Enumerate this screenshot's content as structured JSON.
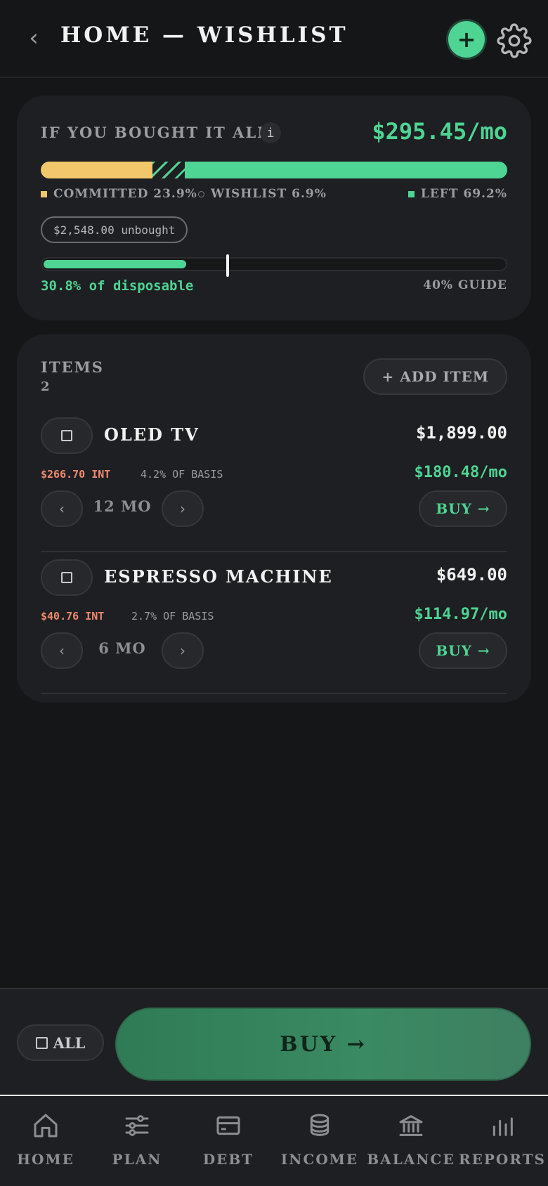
{
  "header": {
    "title": "HOME — WISHLIST"
  },
  "summary": {
    "label": "IF YOU BOUGHT IT ALL",
    "info_glyph": "i",
    "monthly_total": "$295.45/mo",
    "breakdown": {
      "committed_pct": 23.9,
      "wishlist_pct": 6.9,
      "left_pct": 69.2
    },
    "legend": {
      "committed": "COMMITTED 23.9%",
      "wishlist": "WISHLIST 6.9%",
      "left": "LEFT 69.2%"
    },
    "unbought": "$2,548.00 unbought",
    "disposable_fraction": 0.308,
    "guide_fraction": 0.4,
    "disposable_text": "30.8% of disposable",
    "guide_text": "40% GUIDE"
  },
  "items_section": {
    "label": "ITEMS",
    "count": "2",
    "add_label": "+ ADD ITEM",
    "items": [
      {
        "name": "OLED TV",
        "price": "$1,899.00",
        "interest": "$266.70 INT",
        "basis": "4.2% OF BASIS",
        "monthly": "$180.48/mo",
        "term": "12 MO",
        "buy_label": "BUY →"
      },
      {
        "name": "ESPRESSO MACHINE",
        "price": "$649.00",
        "interest": "$40.76 INT",
        "basis": "2.7% OF BASIS",
        "monthly": "$114.97/mo",
        "term": "6 MO",
        "buy_label": "BUY →"
      }
    ]
  },
  "action_bar": {
    "all_label": "ALL",
    "buy_label": "BUY →"
  },
  "tabs": [
    {
      "label": "HOME",
      "icon": "home-icon"
    },
    {
      "label": "PLAN",
      "icon": "sliders-icon"
    },
    {
      "label": "DEBT",
      "icon": "card-icon"
    },
    {
      "label": "INCOME",
      "icon": "coins-icon"
    },
    {
      "label": "BALANCE",
      "icon": "bank-icon"
    },
    {
      "label": "REPORTS",
      "icon": "bar-chart-icon"
    }
  ],
  "colors": {
    "accent_green": "#4ed493",
    "committed_yellow": "#f2c66a",
    "interest_red": "#f08a6e",
    "background": "#151618",
    "card": "#1e1f22"
  }
}
